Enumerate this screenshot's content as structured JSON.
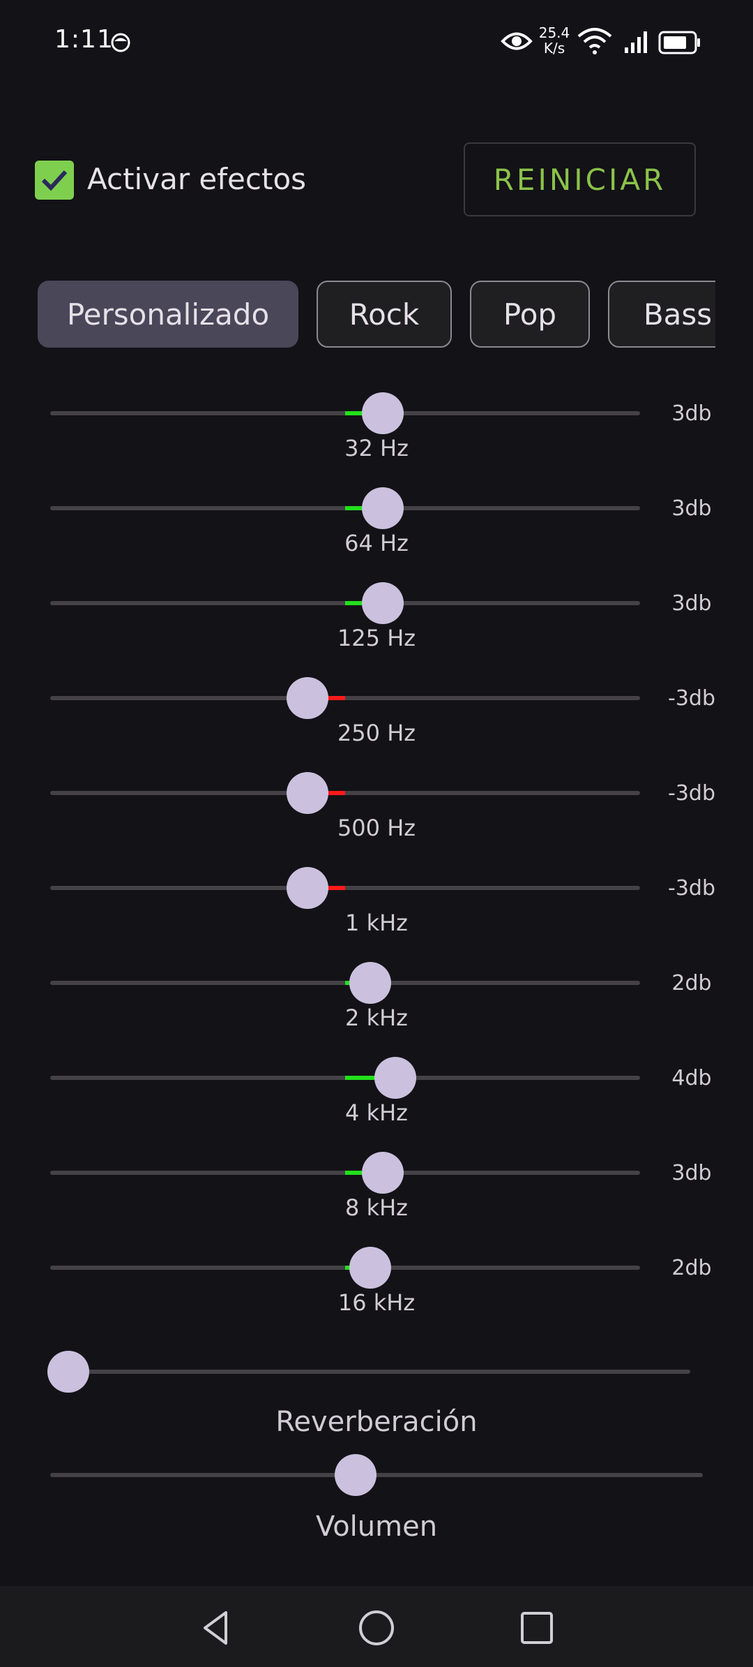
{
  "status": {
    "time": "1:11",
    "speed_value": "25.4",
    "speed_unit": "K/s"
  },
  "controls": {
    "enable_label": "Activar efectos",
    "enable_checked": true,
    "reset_label": "REINICIAR"
  },
  "presets": [
    {
      "label": "Personalizado",
      "active": true
    },
    {
      "label": "Rock",
      "active": false
    },
    {
      "label": "Pop",
      "active": false
    },
    {
      "label": "Bass",
      "active": false
    }
  ],
  "bands": [
    {
      "freq": "32 Hz",
      "gain_label": "3db",
      "value": 3
    },
    {
      "freq": "64 Hz",
      "gain_label": "3db",
      "value": 3
    },
    {
      "freq": "125 Hz",
      "gain_label": "3db",
      "value": 3
    },
    {
      "freq": "250 Hz",
      "gain_label": "-3db",
      "value": -3
    },
    {
      "freq": "500 Hz",
      "gain_label": "-3db",
      "value": -3
    },
    {
      "freq": "1 kHz",
      "gain_label": "-3db",
      "value": -3
    },
    {
      "freq": "2 kHz",
      "gain_label": "2db",
      "value": 2
    },
    {
      "freq": "4 kHz",
      "gain_label": "4db",
      "value": 4
    },
    {
      "freq": "8 kHz",
      "gain_label": "3db",
      "value": 3
    },
    {
      "freq": "16 kHz",
      "gain_label": "2db",
      "value": 2
    }
  ],
  "band_range": [
    -15,
    15
  ],
  "colors": {
    "positive": "#22e01c",
    "negative": "#ff1a1a",
    "accent": "#8bc34a",
    "thumb": "#cbc1de"
  },
  "reverb": {
    "label": "Reverberación",
    "level": 0.0
  },
  "volume": {
    "label": "Volumen",
    "level": 0.5
  }
}
